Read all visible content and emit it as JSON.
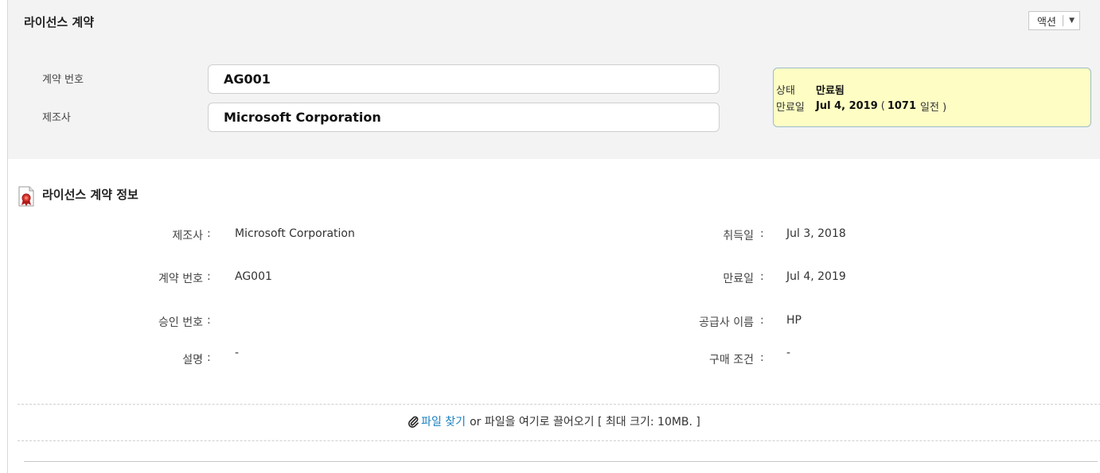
{
  "header": {
    "title": "라이선스 계약",
    "action_label": "액션",
    "action_caret": "▼"
  },
  "summary": {
    "agreement_number_label": "계약 번호",
    "agreement_number_value": "AG001",
    "manufacturer_label": "제조사",
    "manufacturer_value": "Microsoft Corporation"
  },
  "status_panel": {
    "status_label": "상태",
    "status_value": "만료됨",
    "expiry_label": "만료일",
    "expiry_date": "Jul 4, 2019",
    "days_open": "(",
    "days_value": "1071",
    "days_suffix": "일전 )"
  },
  "section": {
    "title": "라이선스 계약 정보",
    "colon": ":",
    "left": [
      {
        "label": "제조사",
        "value": "Microsoft Corporation"
      },
      {
        "label": "계약 번호",
        "value": "AG001"
      },
      {
        "label": "승인 번호",
        "value": ""
      },
      {
        "label": "설명",
        "value": "-"
      }
    ],
    "right": [
      {
        "label": "취득일",
        "value": "Jul 3, 2018"
      },
      {
        "label": "만료일",
        "value": "Jul 4, 2019"
      },
      {
        "label": "공급사 이름",
        "value": "HP"
      },
      {
        "label": "구매 조건",
        "value": "-"
      }
    ]
  },
  "upload": {
    "browse_link": "파일 찾기",
    "rest_text": "or 파일을 여기로 끌어오기 [ 최대 크기: 10MB. ]"
  },
  "colors": {
    "status_bg": "#fefec4",
    "status_border": "#9bbccb",
    "link": "#1a7fc1",
    "header_bg": "#f3f3f3"
  },
  "icons": {
    "section_icon": "certificate-icon",
    "upload_icon": "paperclip-icon",
    "action_icon": "caret-down-icon"
  }
}
